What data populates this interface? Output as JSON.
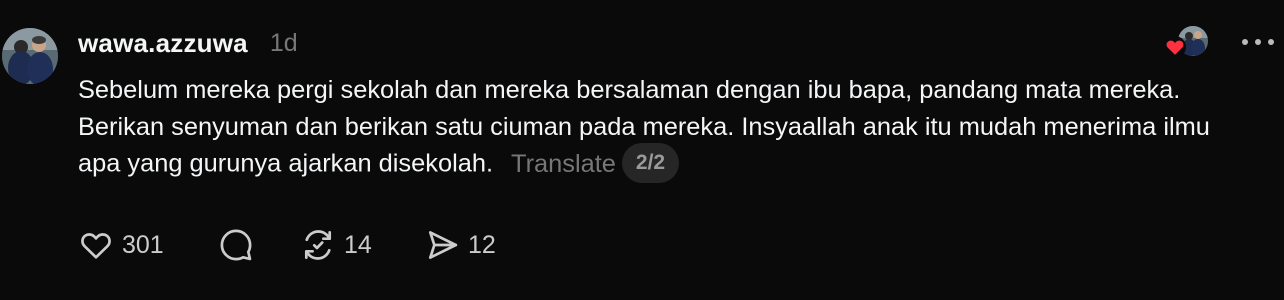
{
  "post": {
    "username": "wawa.azzuwa",
    "time": "1d",
    "text": "Sebelum mereka pergi sekolah dan mereka bersalaman dengan ibu bapa, pandang mata mereka. Berikan senyuman dan berikan satu ciuman pada mereka. Insyaallah anak itu mudah menerima ilmu apa yang gurunya ajarkan disekolah.",
    "translate_label": "Translate",
    "page_indicator": "2/2"
  },
  "actions": {
    "like_count": "301",
    "repost_count": "14",
    "share_count": "12"
  },
  "colors": {
    "background": "#0a0a0a",
    "text": "#f3f5f7",
    "muted": "#777777",
    "heart": "#ff3040"
  },
  "icons": {
    "avatar": "avatar",
    "like": "heart-icon",
    "reply": "comment-icon",
    "repost": "repost-icon",
    "share": "send-icon",
    "more": "more-icon"
  }
}
